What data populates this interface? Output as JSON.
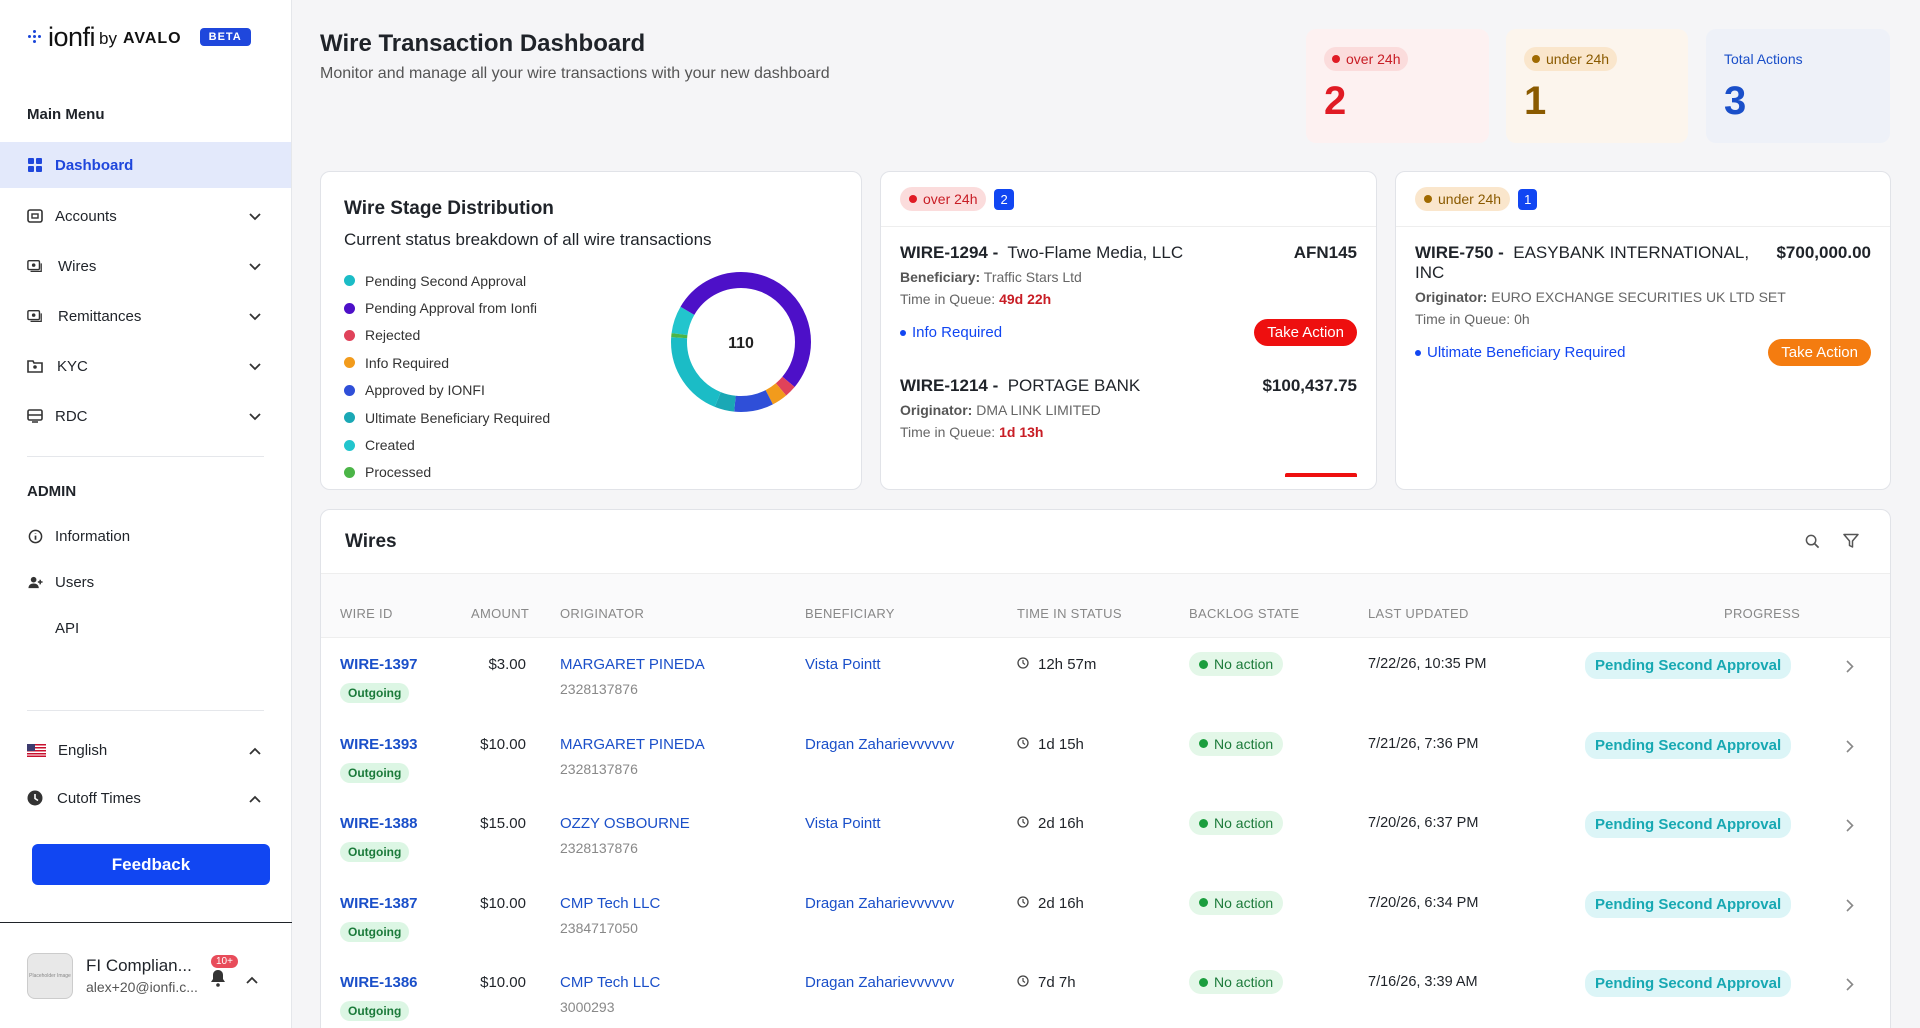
{
  "brand": {
    "name": "ionfi",
    "by": "by",
    "partner": "AVALO",
    "badge": "BETA"
  },
  "sidebar": {
    "main_menu_title": "Main Menu",
    "items": [
      {
        "label": "Dashboard",
        "icon": "dashboard-grid-icon"
      },
      {
        "label": "Accounts",
        "icon": "accounts-icon"
      },
      {
        "label": "Wires",
        "icon": "wires-icon"
      },
      {
        "label": "Remittances",
        "icon": "remittances-icon"
      },
      {
        "label": "KYC",
        "icon": "kyc-icon"
      },
      {
        "label": "RDC",
        "icon": "rdc-icon"
      }
    ],
    "admin_title": "ADMIN",
    "admin_items": [
      {
        "label": "Information",
        "icon": "info-icon"
      },
      {
        "label": "Users",
        "icon": "users-icon"
      },
      {
        "label": "API",
        "icon": ""
      }
    ],
    "language": "English",
    "cutoff": "Cutoff Times",
    "feedback": "Feedback",
    "user": {
      "name": "FI Complian...",
      "email": "alex+20@ionfi.c...",
      "notifications": "10+",
      "avatar_text": "Placeholder Image"
    }
  },
  "header": {
    "title": "Wire Transaction Dashboard",
    "subtitle": "Monitor and manage all your wire transactions with your new dashboard"
  },
  "kpis": [
    {
      "label": "over 24h",
      "value": "2",
      "color": "#e01b24",
      "bg": "#fdf1f1",
      "pill_bg": "#fbdcdc"
    },
    {
      "label": "under 24h",
      "value": "1",
      "color": "#8a5a00",
      "bg": "#fcf5ed",
      "pill_bg": "#fae6cc"
    },
    {
      "label": "Total Actions",
      "value": "3",
      "color": "#1a4fc9",
      "bg": "#eef1f8",
      "pill_bg": ""
    }
  ],
  "distribution": {
    "title": "Wire Stage Distribution",
    "subtitle": "Current status breakdown of all wire transactions",
    "total": "110",
    "legend": [
      {
        "label": "Pending Second Approval",
        "color": "#1bbcc6"
      },
      {
        "label": "Pending Approval from Ionfi",
        "color": "#4d10c8"
      },
      {
        "label": "Rejected",
        "color": "#e0425a"
      },
      {
        "label": "Info Required",
        "color": "#f29b1c"
      },
      {
        "label": "Approved by IONFI",
        "color": "#2f4fd8"
      },
      {
        "label": "Ultimate Beneficiary Required",
        "color": "#1aa8b5"
      },
      {
        "label": "Created",
        "color": "#22c5cd"
      },
      {
        "label": "Processed",
        "color": "#4bb547"
      }
    ],
    "chart_data": {
      "type": "pie",
      "categories": [
        "Pending Second Approval",
        "Pending Approval from Ionfi",
        "Rejected",
        "Info Required",
        "Approved by IONFI",
        "Ultimate Beneficiary Required",
        "Created",
        "Processed"
      ],
      "values": [
        22,
        58,
        3,
        4,
        10,
        5,
        7,
        1
      ]
    }
  },
  "queue_over": {
    "label": "over 24h",
    "count": "2",
    "items": [
      {
        "id": "WIRE-1294 -",
        "name": "Two-Flame Media, LLC",
        "amount": "AFN145",
        "party_label": "Beneficiary:",
        "party": "Traffic Stars Ltd",
        "queue_label": "Time in Queue:",
        "queue": "49d 22h",
        "info": "Info Required",
        "action": "Take Action"
      },
      {
        "id": "WIRE-1214 -",
        "name": "PORTAGE BANK",
        "amount": "$100,437.75",
        "party_label": "Originator:",
        "party": "DMA LINK LIMITED",
        "queue_label": "Time in Queue:",
        "queue": "1d 13h"
      }
    ]
  },
  "queue_under": {
    "label": "under 24h",
    "count": "1",
    "items": [
      {
        "id": "WIRE-750 -",
        "name": "EASYBANK INTERNATIONAL,",
        "name2": "INC",
        "amount": "$700,000.00",
        "party_label": "Originator:",
        "party": "EURO EXCHANGE SECURITIES UK LTD SET",
        "queue_label": "Time in Queue:",
        "queue": "0h",
        "info": "Ultimate Beneficiary Required",
        "action": "Take Action"
      }
    ]
  },
  "wires": {
    "title": "Wires",
    "columns": [
      "WIRE ID",
      "AMOUNT",
      "ORIGINATOR",
      "BENEFICIARY",
      "TIME IN STATUS",
      "BACKLOG STATE",
      "LAST UPDATED",
      "PROGRESS"
    ],
    "rows": [
      {
        "id": "WIRE-1397",
        "type": "Outgoing",
        "amount": "$3.00",
        "originator": "MARGARET PINEDA",
        "orig_acct": "2328137876",
        "beneficiary": "Vista Pointt",
        "time": "12h 57m",
        "backlog": "No action",
        "updated": "7/22/26, 10:35 PM",
        "progress": "Pending Second Approval"
      },
      {
        "id": "WIRE-1393",
        "type": "Outgoing",
        "amount": "$10.00",
        "originator": "MARGARET PINEDA",
        "orig_acct": "2328137876",
        "beneficiary": "Dragan Zaharievvvvvv",
        "time": "1d 15h",
        "backlog": "No action",
        "updated": "7/21/26, 7:36 PM",
        "progress": "Pending Second Approval"
      },
      {
        "id": "WIRE-1388",
        "type": "Outgoing",
        "amount": "$15.00",
        "originator": "OZZY OSBOURNE",
        "orig_acct": "2328137876",
        "beneficiary": "Vista Pointt",
        "time": "2d 16h",
        "backlog": "No action",
        "updated": "7/20/26, 6:37 PM",
        "progress": "Pending Second Approval"
      },
      {
        "id": "WIRE-1387",
        "type": "Outgoing",
        "amount": "$10.00",
        "originator": "CMP Tech LLC",
        "orig_acct": "2384717050",
        "beneficiary": "Dragan Zaharievvvvvv",
        "time": "2d 16h",
        "backlog": "No action",
        "updated": "7/20/26, 6:34 PM",
        "progress": "Pending Second Approval"
      },
      {
        "id": "WIRE-1386",
        "type": "Outgoing",
        "amount": "$10.00",
        "originator": "CMP Tech LLC",
        "orig_acct": "3000293",
        "beneficiary": "Dragan Zaharievvvvvv",
        "time": "7d 7h",
        "backlog": "No action",
        "updated": "7/16/26, 3:39 AM",
        "progress": "Pending Second Approval"
      }
    ]
  }
}
